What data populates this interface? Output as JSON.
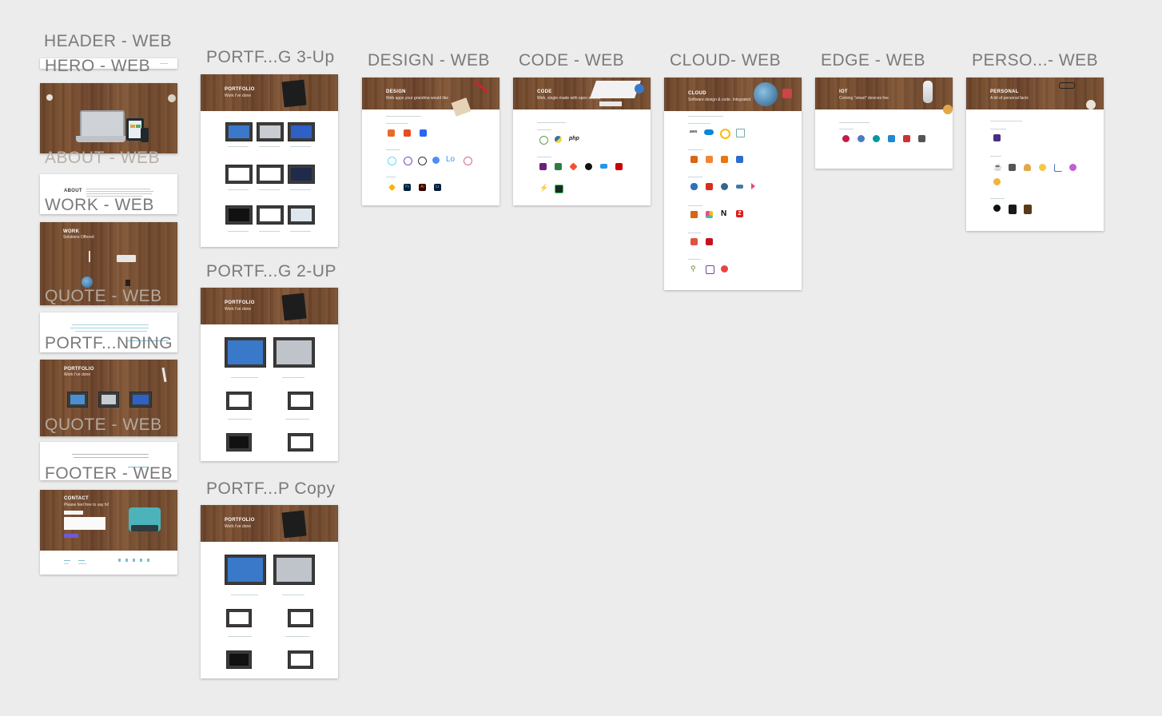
{
  "labels": {
    "header_web": "HEADER - WEB",
    "hero_web": "HERO - WEB",
    "about_web": "ABOUT - WEB",
    "work_web": "WORK - WEB",
    "quote_web_1": "QUOTE - WEB",
    "portf_nding": "PORTF...NDING",
    "quote_web_2": "QUOTE - WEB",
    "footer_web": "FOOTER - WEB",
    "portf_3up": "PORTF...G 3-Up",
    "portf_2up": "PORTF...G 2-UP",
    "portf_copy": "PORTF...P Copy",
    "design_web": "DESIGN - WEB",
    "code_web": "CODE - WEB",
    "cloud_web": "CLOUD- WEB",
    "edge_web": "EDGE - WEB",
    "personal_web": "PERSO...- WEB"
  },
  "artboards": {
    "about": {
      "title": "ABOUT"
    },
    "work": {
      "title": "WORK",
      "subtitle": "Solutions Offered"
    },
    "portfolio": {
      "title": "PORTFOLIO",
      "subtitle": "Work I've done"
    },
    "contact": {
      "title": "CONTACT",
      "subtitle": "Please feel free to say hi!"
    },
    "design": {
      "title": "DESIGN",
      "subtitle": "Web apps your grandma would like"
    },
    "code": {
      "title": "CODE",
      "subtitle": "Web, single-made with open source"
    },
    "cloud": {
      "title": "CLOUD",
      "subtitle": "Software design & code. Integrated"
    },
    "iot": {
      "title": "IOT",
      "subtitle": "Coming \"smart\" devices live"
    },
    "personal": {
      "title": "PERSONAL",
      "subtitle": "A bit of personal facts"
    }
  },
  "icon_text": {
    "php": "php",
    "lo": "Lo",
    "aws": "aws",
    "n": "N",
    "z": "Z",
    "ps": "Ps",
    "ai": "Ai",
    "lr": "Lr"
  },
  "colors": {
    "canvas": "#ececec",
    "label": "#7a7a7a",
    "wood": "#7a5031",
    "accent": "#3fa7c4"
  }
}
